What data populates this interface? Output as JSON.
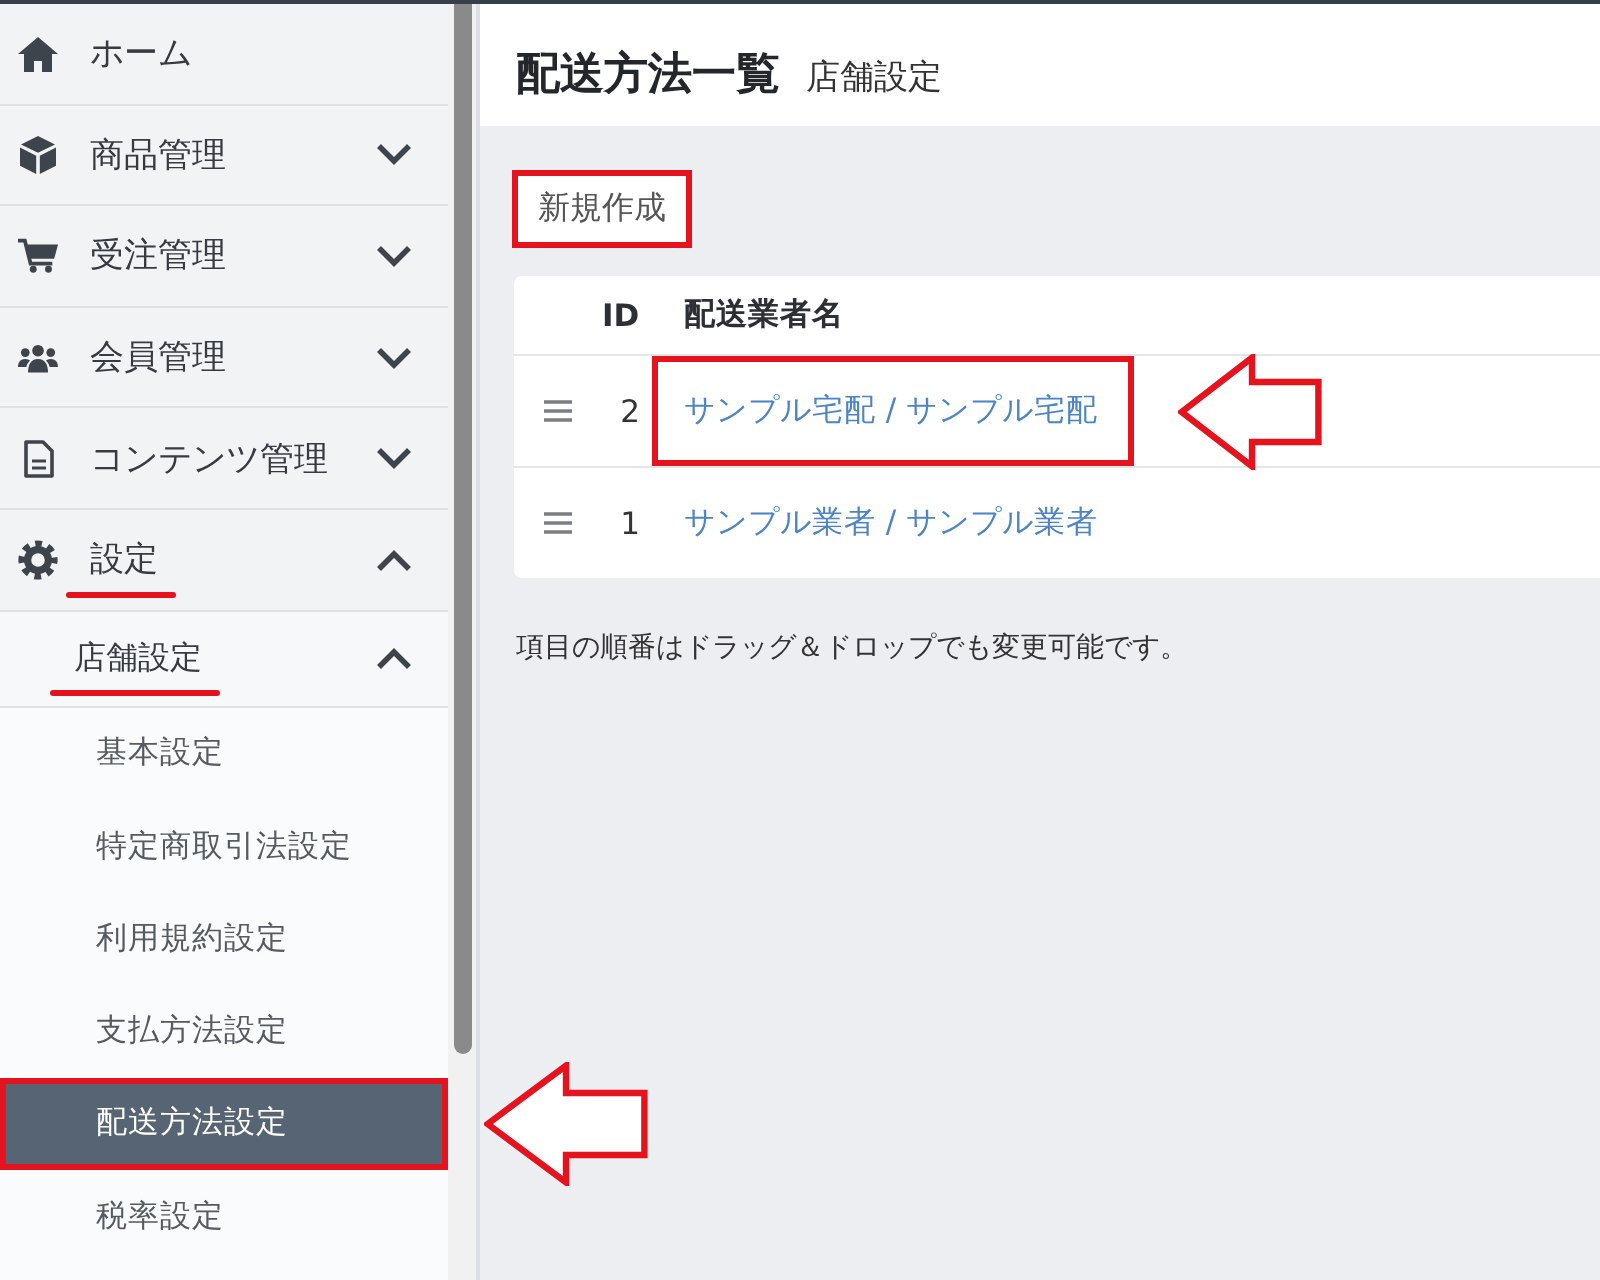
{
  "sidebar": {
    "items": [
      {
        "label": "ホーム",
        "kind": "link",
        "selected": false,
        "underlined": false
      },
      {
        "label": "商品管理",
        "kind": "group",
        "expanded": false,
        "underlined": false
      },
      {
        "label": "受注管理",
        "kind": "group",
        "expanded": false,
        "underlined": false
      },
      {
        "label": "会員管理",
        "kind": "group",
        "expanded": false,
        "underlined": false
      },
      {
        "label": "コンテンツ管理",
        "kind": "group",
        "expanded": false,
        "underlined": false
      },
      {
        "label": "設定",
        "kind": "group",
        "expanded": true,
        "underlined": true,
        "children": [
          {
            "label": "店舗設定",
            "kind": "group",
            "expanded": true,
            "underlined": true,
            "children": [
              {
                "label": "基本設定",
                "selected": false,
                "highlighted": false,
                "arrow": false
              },
              {
                "label": "特定商取引法設定",
                "selected": false,
                "highlighted": false,
                "arrow": false
              },
              {
                "label": "利用規約設定",
                "selected": false,
                "highlighted": false,
                "arrow": false
              },
              {
                "label": "支払方法設定",
                "selected": false,
                "highlighted": false,
                "arrow": false
              },
              {
                "label": "配送方法設定",
                "selected": true,
                "highlighted": true,
                "arrow": true
              },
              {
                "label": "税率設定",
                "selected": false,
                "highlighted": false,
                "arrow": false
              }
            ]
          }
        ]
      }
    ]
  },
  "page_header": {
    "title": "配送方法一覧",
    "subtitle": "店舗設定"
  },
  "new_button": {
    "label": "新規作成",
    "highlighted": true
  },
  "table": {
    "columns": [
      "ID",
      "配送業者名"
    ],
    "rows": [
      {
        "id": "2",
        "name": "サンプル宅配 / サンプル宅配",
        "highlighted": true,
        "arrow": true
      },
      {
        "id": "1",
        "name": "サンプル業者 / サンプル業者",
        "highlighted": false,
        "arrow": false
      }
    ]
  },
  "note": "項目の順番はドラッグ＆ドロップでも変更可能です。"
}
